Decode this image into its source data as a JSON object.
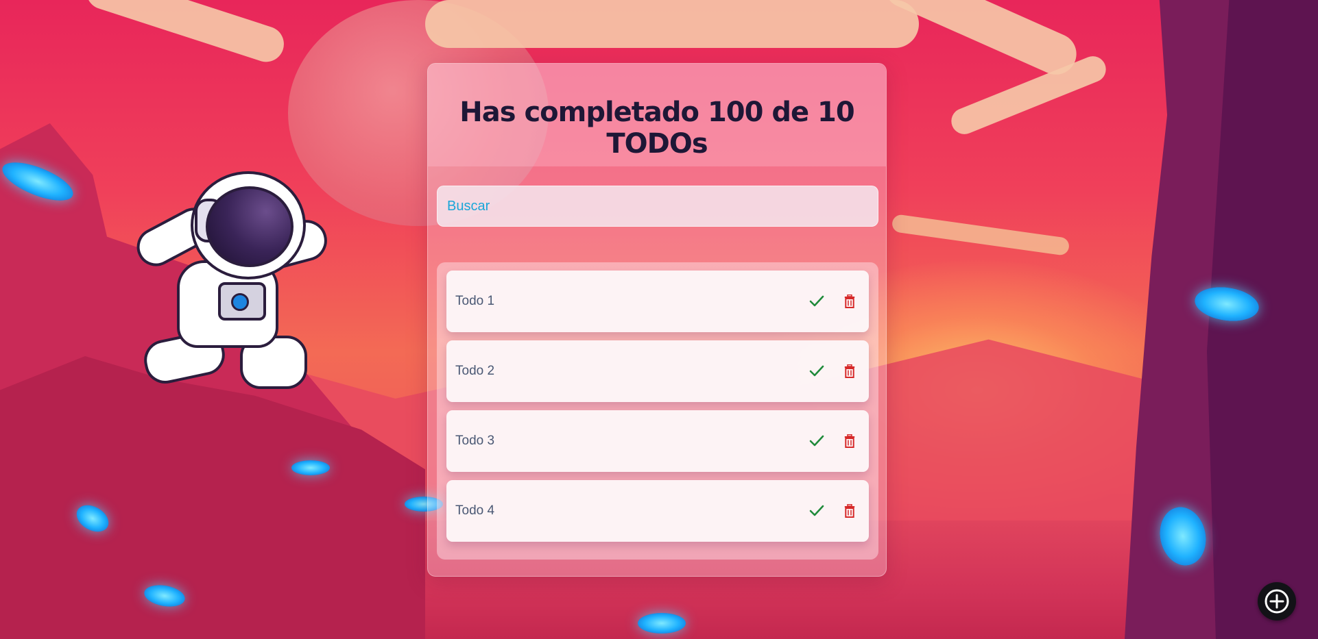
{
  "header": {
    "title": "Has completado 100 de 10 TODOs"
  },
  "search": {
    "placeholder": "Buscar",
    "value": ""
  },
  "todos": [
    {
      "text": "Todo 1",
      "completed": false
    },
    {
      "text": "Todo 2",
      "completed": false
    },
    {
      "text": "Todo 3",
      "completed": false
    },
    {
      "text": "Todo 4",
      "completed": false
    }
  ],
  "icons": {
    "complete": "check-icon",
    "delete": "trash-icon",
    "add": "plus-circle-icon"
  },
  "colors": {
    "check": "#1f8a3a",
    "delete": "#d62828",
    "placeholder": "#1aa6d8",
    "title": "#1e1736"
  }
}
